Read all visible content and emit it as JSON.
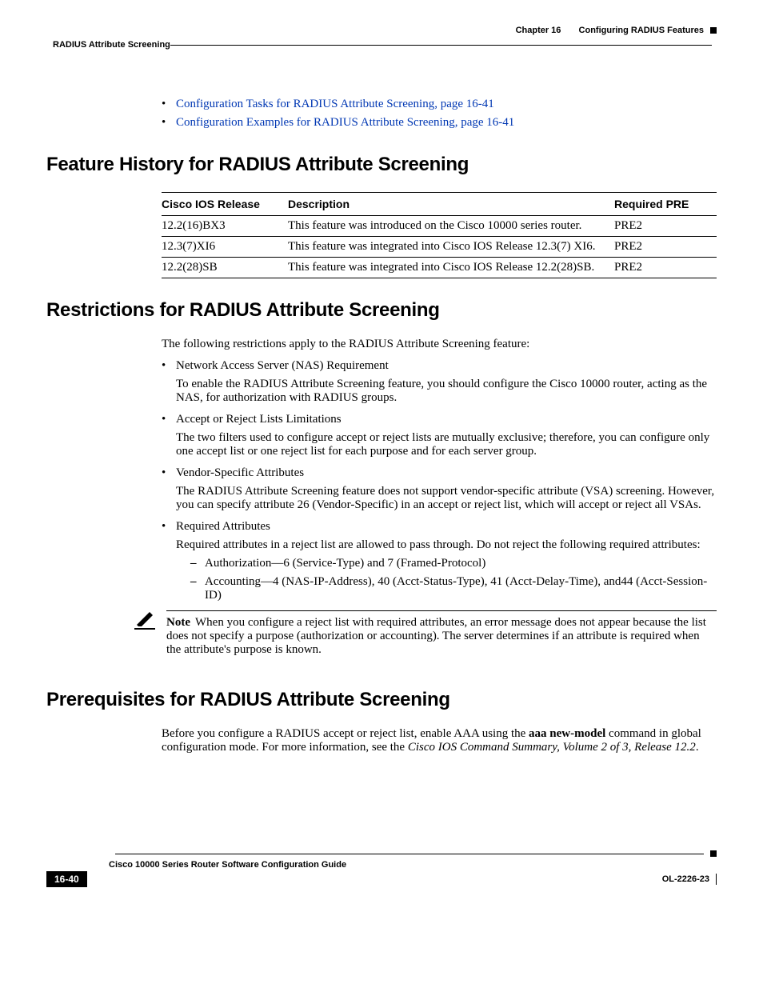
{
  "header": {
    "chapter_label": "Chapter 16",
    "chapter_title": "Configuring RADIUS Features",
    "breadcrumb": "RADIUS Attribute Screening"
  },
  "toc_links": [
    "Configuration Tasks for RADIUS Attribute Screening, page 16-41",
    "Configuration Examples for RADIUS Attribute Screening, page 16-41"
  ],
  "section1": {
    "title": "Feature History for RADIUS Attribute Screening",
    "table": {
      "headers": [
        "Cisco IOS Release",
        "Description",
        "Required PRE"
      ],
      "rows": [
        {
          "release": "12.2(16)BX3",
          "desc": "This feature was introduced on the Cisco 10000 series router.",
          "pre": "PRE2"
        },
        {
          "release": "12.3(7)XI6",
          "desc": "This feature was integrated into Cisco IOS Release 12.3(7) XI6.",
          "pre": "PRE2"
        },
        {
          "release": "12.2(28)SB",
          "desc": "This feature was integrated into Cisco IOS Release 12.2(28)SB.",
          "pre": "PRE2"
        }
      ]
    }
  },
  "section2": {
    "title": "Restrictions for RADIUS Attribute Screening",
    "intro": "The following restrictions apply to the RADIUS Attribute Screening feature:",
    "items": [
      {
        "head": "Network Access Server (NAS) Requirement",
        "body": "To enable the RADIUS Attribute Screening feature, you should configure the Cisco 10000 router, acting as the NAS, for authorization with RADIUS groups."
      },
      {
        "head": "Accept or Reject Lists Limitations",
        "body": "The two filters used to configure accept or reject lists are mutually exclusive; therefore, you can configure only one accept list or one reject list for each purpose and for each server group."
      },
      {
        "head": "Vendor-Specific Attributes",
        "body": "The RADIUS Attribute Screening feature does not support vendor-specific attribute (VSA) screening. However, you can specify attribute 26 (Vendor-Specific) in an accept or reject list, which will accept or reject all VSAs."
      },
      {
        "head": "Required Attributes",
        "body": "Required attributes in a reject list are allowed to pass through. Do not reject the following required attributes:",
        "sub": [
          "Authorization—6 (Service-Type) and 7 (Framed-Protocol)",
          "Accounting—4 (NAS-IP-Address), 40 (Acct-Status-Type), 41 (Acct-Delay-Time), and44 (Acct-Session-ID)"
        ]
      }
    ],
    "note_label": "Note",
    "note": "When you configure a reject list with required attributes, an error message does not appear because the list does not specify a purpose (authorization or accounting). The server determines if an attribute is required when the attribute's purpose is known."
  },
  "section3": {
    "title": "Prerequisites for RADIUS Attribute Screening",
    "para_pre": "Before you configure a RADIUS accept or reject list, enable AAA using the ",
    "cmd": "aaa new-model",
    "para_mid": " command in global configuration mode. For more information, see the ",
    "ref": "Cisco IOS Command Summary, Volume 2 of 3, Release 12.2",
    "para_post": "."
  },
  "footer": {
    "book": "Cisco 10000 Series Router Software Configuration Guide",
    "page": "16-40",
    "doc_id": "OL-2226-23"
  }
}
